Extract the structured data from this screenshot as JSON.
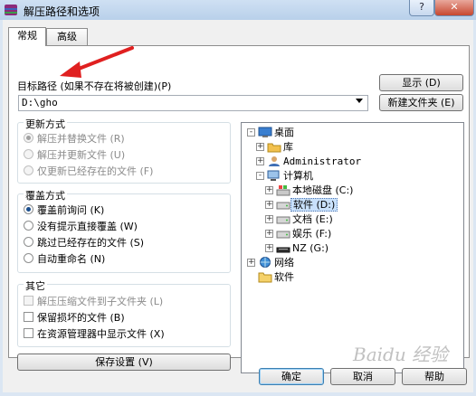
{
  "window": {
    "title": "解压路径和选项",
    "help_label": "?",
    "close_label": "✕",
    "icon": "winrar-icon"
  },
  "tabs": [
    {
      "label": "常规",
      "active": true
    },
    {
      "label": "高级",
      "active": false
    }
  ],
  "target": {
    "label": "目标路径 (如果不存在将被创建)(P)",
    "value": "D:\\gho",
    "show_button": "显示 (D)",
    "new_folder_button": "新建文件夹 (E)"
  },
  "update_mode": {
    "title": "更新方式",
    "options": [
      {
        "label": "解压并替换文件 (R)",
        "checked": true,
        "disabled": true
      },
      {
        "label": "解压并更新文件 (U)",
        "checked": false,
        "disabled": true
      },
      {
        "label": "仅更新已经存在的文件 (F)",
        "checked": false,
        "disabled": true
      }
    ]
  },
  "overwrite_mode": {
    "title": "覆盖方式",
    "options": [
      {
        "label": "覆盖前询问 (K)",
        "checked": true
      },
      {
        "label": "没有提示直接覆盖 (W)",
        "checked": false
      },
      {
        "label": "跳过已经存在的文件 (S)",
        "checked": false
      },
      {
        "label": "自动重命名 (N)",
        "checked": false
      }
    ]
  },
  "misc": {
    "title": "其它",
    "options": [
      {
        "label": "解压压缩文件到子文件夹 (L)",
        "checked": false,
        "disabled": true
      },
      {
        "label": "保留损坏的文件 (B)",
        "checked": false,
        "disabled": false
      },
      {
        "label": "在资源管理器中显示文件 (X)",
        "checked": false,
        "disabled": false
      }
    ]
  },
  "save_settings_button": "保存设置 (V)",
  "tree": [
    {
      "label": "桌面",
      "icon": "desktop-icon",
      "expander": "-"
    },
    {
      "label": "库",
      "icon": "library-icon",
      "expander": "+"
    },
    {
      "label": "Administrator",
      "icon": "user-icon",
      "expander": "+"
    },
    {
      "label": "计算机",
      "icon": "computer-icon",
      "expander": "-"
    },
    {
      "label": "本地磁盘 (C:)",
      "icon": "drive-c-icon",
      "expander": "+"
    },
    {
      "label": "软件 (D:)",
      "icon": "drive-icon",
      "expander": "+",
      "selected": true
    },
    {
      "label": "文档 (E:)",
      "icon": "drive-icon",
      "expander": "+"
    },
    {
      "label": "娱乐 (F:)",
      "icon": "drive-icon",
      "expander": "+"
    },
    {
      "label": "NZ (G:)",
      "icon": "drive-icon",
      "expander": "+"
    },
    {
      "label": "网络",
      "icon": "network-icon",
      "expander": "+"
    },
    {
      "label": "软件",
      "icon": "folder-icon",
      "expander": ""
    }
  ],
  "buttons": {
    "ok": "确定",
    "cancel": "取消",
    "help": "帮助"
  },
  "watermark": "Baidu 经验",
  "colors": {
    "title_bar": "#c4d8ee",
    "annotation_arrow": "#e02020",
    "selection": "#c9e1fb"
  }
}
